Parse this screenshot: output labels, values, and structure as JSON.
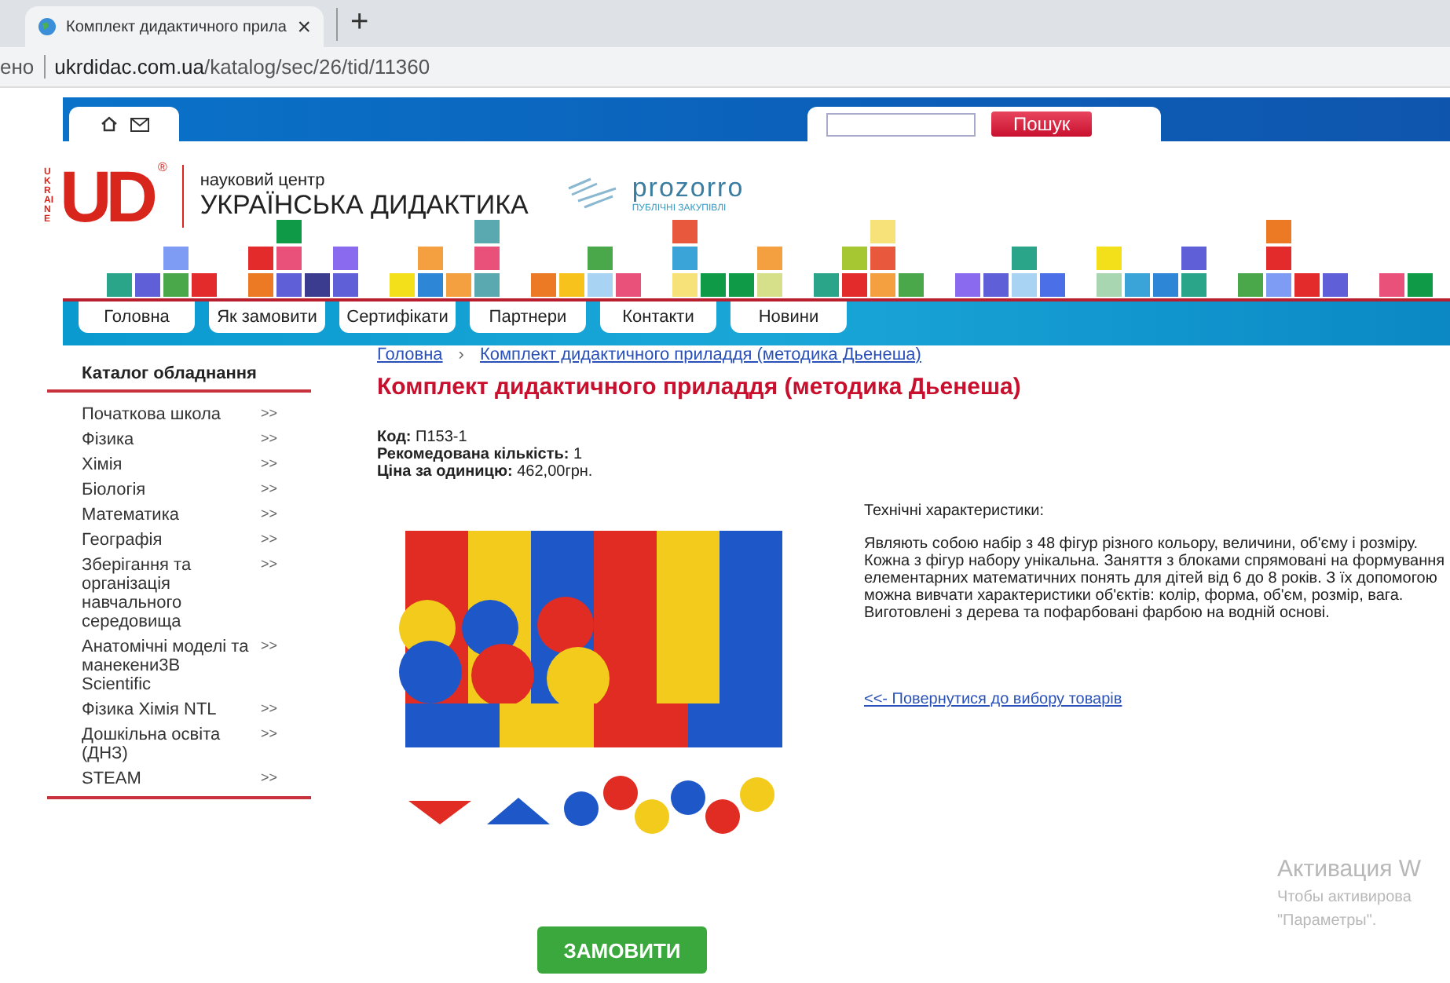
{
  "browser": {
    "tab_title": "Комплект дидактичного прила",
    "close": "×",
    "new_tab": "+",
    "url_prefix": "ено",
    "url_host": "ukrdidac.com.ua",
    "url_path": "/katalog/sec/26/tid/11360"
  },
  "header": {
    "search_button": "Пошук",
    "logo": {
      "mark": "UD",
      "registered": "®",
      "side": "UKRAINE",
      "subtitle": "науковий центр",
      "title": "УКРАЇНСЬКА ДИДАКТИКА"
    },
    "partner": {
      "name": "prozorro",
      "tagline": "ПУБЛІЧНІ ЗАКУПІВЛІ"
    }
  },
  "nav": [
    "Головна",
    "Як замовити",
    "Сертифікати",
    "Партнери",
    "Контакти",
    "Новини"
  ],
  "sidebar": {
    "title": "Каталог обладнання",
    "items": [
      {
        "label": "Початкова школа",
        "arrow": ">>"
      },
      {
        "label": "Фізика",
        "arrow": ">>"
      },
      {
        "label": "Хімія",
        "arrow": ">>"
      },
      {
        "label": "Біологія",
        "arrow": ">>"
      },
      {
        "label": "Математика",
        "arrow": ">>"
      },
      {
        "label": "Географія",
        "arrow": ">>"
      },
      {
        "label": "Зберігання та організація навчального середовища",
        "arrow": ">>"
      },
      {
        "label": "Анатомічні моделі та манекени3B Scientific",
        "arrow": ">>"
      },
      {
        "label": "Фізика Хімія NTL",
        "arrow": ">>"
      },
      {
        "label": "Дошкільна освіта (ДНЗ)",
        "arrow": ">>"
      },
      {
        "label": "STEAM",
        "arrow": ">>"
      }
    ]
  },
  "breadcrumb": {
    "items": [
      "Головна",
      "Комплект дидактичного приладдя (методика Дьенеша)"
    ],
    "separator": "›"
  },
  "product": {
    "title": "Комплект дидактичного приладдя (методика Дьенеша)",
    "fields": [
      {
        "label": "Код:",
        "value": "П153-1"
      },
      {
        "label": "Рекомедована кількість:",
        "value": "1"
      },
      {
        "label": "Ціна за одиницю:",
        "value": "462,00грн."
      }
    ],
    "specs_title": "Технічні характеристики:",
    "description": "Являють собою набір з 48 фігур різного кольору, величини, об'єму і розміру. Кожна з фігур набору унікальна. Заняття з блоками спрямовані на формування елементарних математичних понять для дітей від 6 до 8 років. З їх допомогою можна вивчати характеристики об'єктів: колір, форма, об'єм, розмір, вага. Виготовлені з дерева та пофарбовані фарбою на водній основі.",
    "back_link": "<<- Повернутися до вибору товарів",
    "order_button": "ЗАМОВИТИ"
  },
  "os_notice": {
    "title": "Активация W",
    "line_1": "Чтобы активирова",
    "line_2": "\"Параметры\"."
  }
}
